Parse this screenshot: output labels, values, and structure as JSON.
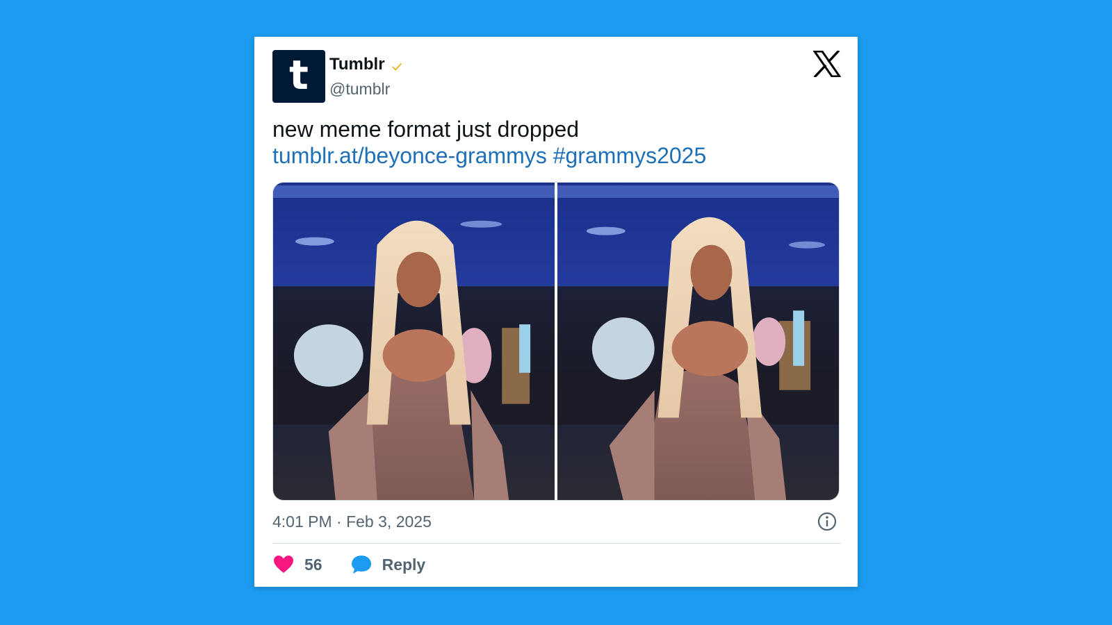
{
  "account": {
    "display_name": "Tumblr",
    "handle": "@tumblr",
    "avatar_letter": "t",
    "avatar_color": "#001935",
    "verified_color": "#e2b719"
  },
  "tweet": {
    "text_line1": "new meme format just dropped",
    "link": "tumblr.at/beyonce-grammys",
    "hashtag": "#grammys2025",
    "timestamp": "4:01 PM · Feb 3, 2025",
    "media_count": 2
  },
  "actions": {
    "like_icon": "heart-icon",
    "like_count": "56",
    "reply_icon": "speech-bubble-icon",
    "reply_label": "Reply"
  },
  "colors": {
    "background": "#1d9bf0",
    "link": "#1d70b8",
    "heart": "#f91880",
    "reply_bubble": "#1d9bf0"
  }
}
